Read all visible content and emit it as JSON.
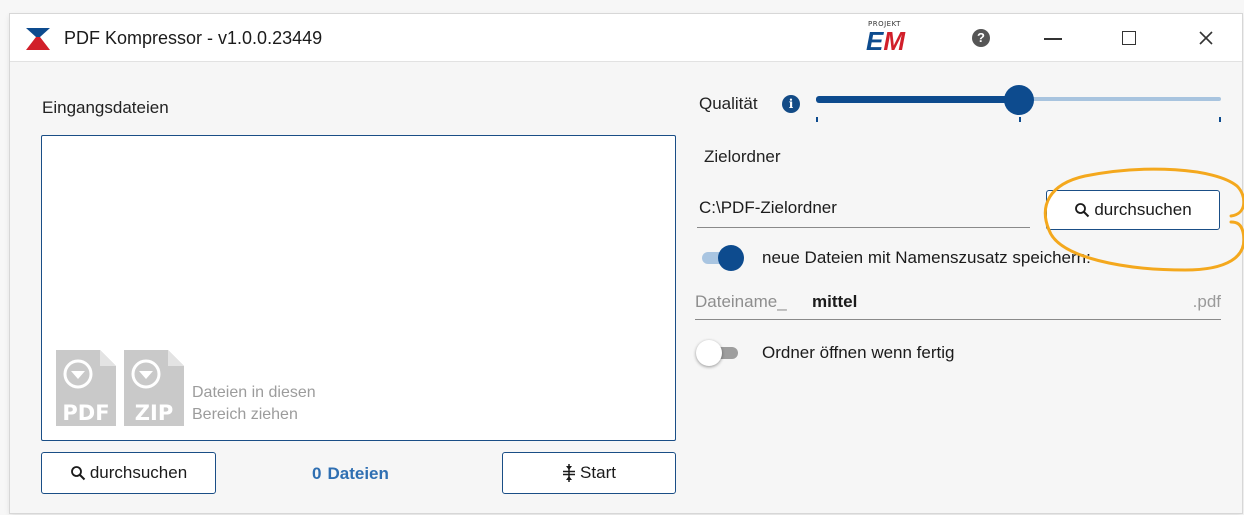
{
  "window": {
    "title": "PDF Kompressor - v1.0.0.23449"
  },
  "brand": {
    "small": "PROJEKT",
    "e": "E",
    "m": "M"
  },
  "titlebar": {
    "help": "?"
  },
  "input": {
    "label": "Eingangsdateien",
    "drop_hint_line1": "Dateien in diesen",
    "drop_hint_line2": "Bereich ziehen",
    "pdf_badge": "PDF",
    "zip_badge": "ZIP",
    "browse_label": "durchsuchen",
    "file_count": "0",
    "file_count_label": "Dateien",
    "start_label": "Start"
  },
  "quality": {
    "label": "Qualität",
    "info": "i",
    "value": 0.5,
    "ticks": [
      0,
      0.5,
      1
    ]
  },
  "target": {
    "label": "Zielordner",
    "path": "C:\\PDF-Zielordner",
    "browse_label": "durchsuchen"
  },
  "options": {
    "suffix_toggle_label": "neue Dateien mit Namenszusatz speichern:",
    "suffix_toggle_on": true,
    "filename_prefix": "Dateiname_",
    "filename_value": "mittel",
    "filename_ext": ".pdf",
    "open_folder_label": "Ordner öffnen wenn fertig",
    "open_folder_on": false
  },
  "colors": {
    "accent": "#0d4b8e",
    "accent_light": "#a8c4df",
    "count_text": "#2f6fb2",
    "highlight": "#f4a81d"
  }
}
